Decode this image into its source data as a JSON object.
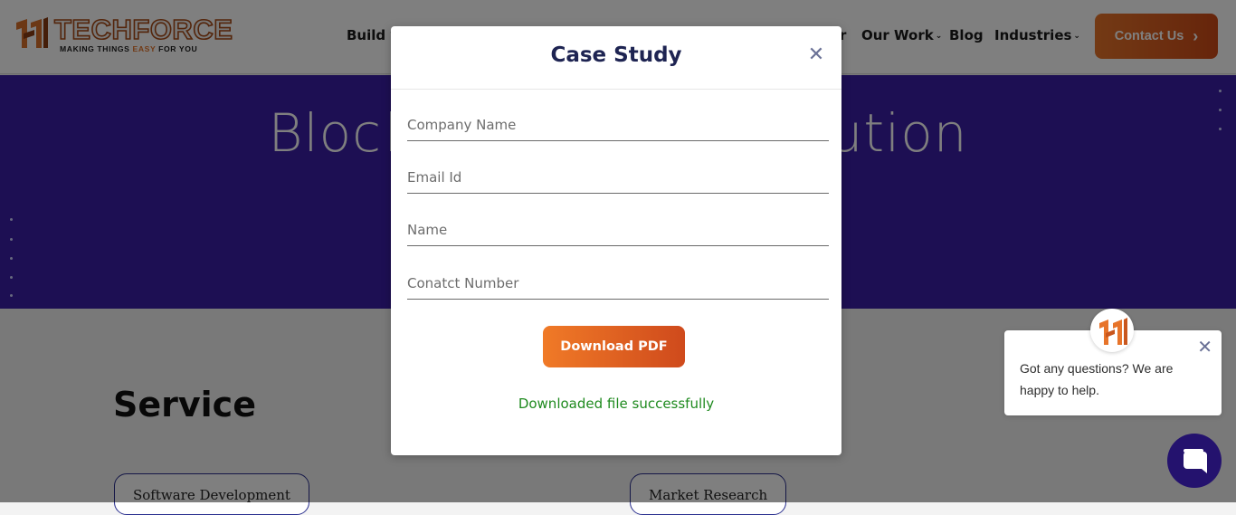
{
  "header": {
    "logo": {
      "word": "TECHFORCE",
      "tagline_pre": "MAKING THINGS ",
      "tagline_easy": "EASY",
      "tagline_post": " FOR YOU"
    },
    "nav": [
      {
        "label": "Build y"
      },
      {
        "label": "r"
      },
      {
        "label": "Our Work"
      },
      {
        "label": "Blog"
      },
      {
        "label": "Industries"
      }
    ],
    "contact_label": "Contact Us"
  },
  "hero": {
    "title_left": "Block",
    "title_right": "ution"
  },
  "service": {
    "title": "Service",
    "pills": [
      {
        "label": "Software Development"
      },
      {
        "label": "Market Research"
      }
    ]
  },
  "modal": {
    "title": "Case Study",
    "fields": [
      {
        "placeholder": "Company Name"
      },
      {
        "placeholder": "Email Id"
      },
      {
        "placeholder": "Name"
      },
      {
        "placeholder": "Conatct Number"
      }
    ],
    "button_label": "Download PDF",
    "success_message": "Downloaded file successfully"
  },
  "chat": {
    "message": "Got any questions? We are happy to help."
  },
  "colors": {
    "accent": "#e7742a",
    "hero_bg": "#3a1fa6",
    "modal_title": "#1e2452",
    "success": "#1e8a1e",
    "chat_launcher": "#24126e"
  },
  "icons": [
    "logo-mark-icon",
    "chevron-right-icon",
    "close-icon",
    "chat-icon",
    "chevron-down-icon"
  ]
}
